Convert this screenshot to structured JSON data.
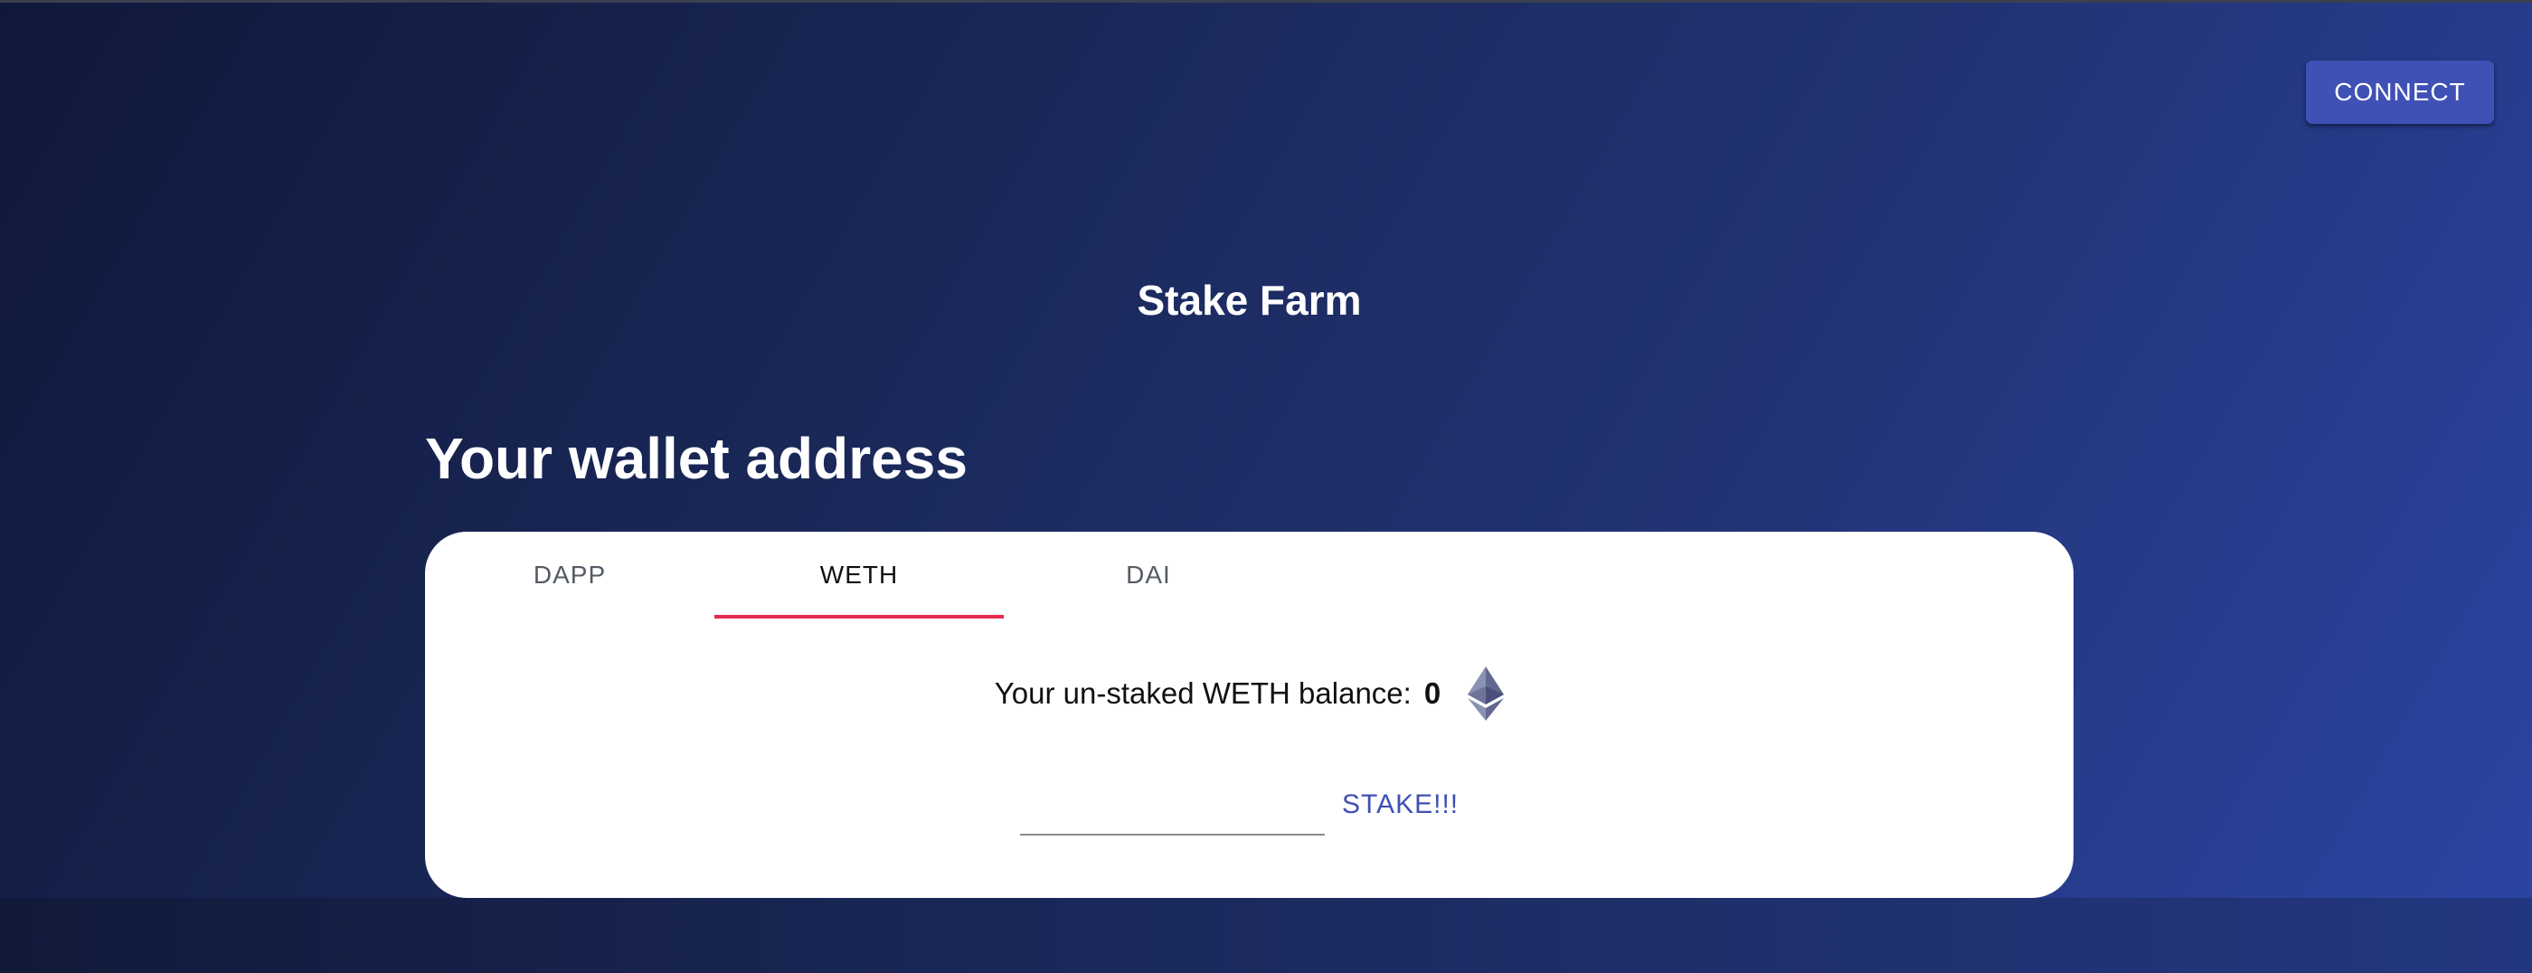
{
  "header": {
    "connect_label": "CONNECT"
  },
  "app": {
    "title": "Stake Farm"
  },
  "wallet": {
    "heading": "Your wallet address"
  },
  "tabs": [
    {
      "label": "DAPP",
      "active": false
    },
    {
      "label": "WETH",
      "active": true
    },
    {
      "label": "DAI",
      "active": false
    }
  ],
  "balance": {
    "label": "Your un-staked WETH balance:",
    "value": "0",
    "token_icon": "ethereum-icon"
  },
  "stake_form": {
    "amount_value": "",
    "amount_placeholder": "",
    "stake_label": "STAKE!!!"
  },
  "colors": {
    "accent": "#3f51b5",
    "tab_indicator": "#e5294f",
    "background_start": "#10183a",
    "background_end": "#2b45a3"
  }
}
